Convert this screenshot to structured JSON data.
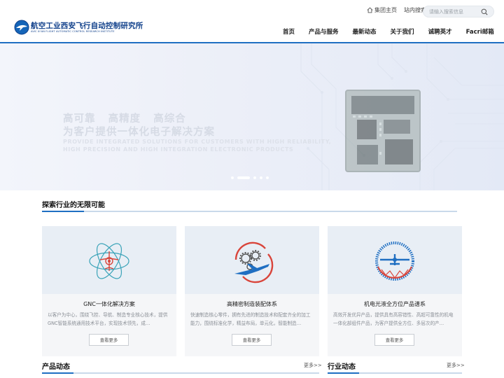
{
  "header": {
    "logo_cn": "航空工业西安飞行自动控制研究所",
    "logo_en": "AVIC XI'AN FLIGHT AUTOMATIC CONTROL RESEARCH INSTITUTE",
    "top_links": [
      "集团主页",
      "站内搜索"
    ],
    "search_placeholder": "请输入搜索信息",
    "nav": [
      "首页",
      "产品与服务",
      "最新动态",
      "关于我们",
      "诚聘英才",
      "Facri邮箱"
    ]
  },
  "banner": {
    "title_line1": "高可靠   高精度   高综合",
    "title_line2": "为客户提供一体化电子解决方案",
    "en_line1": "PROVIDE INTEGRATED SOLUTIONS FOR CUSTOMERS WITH HIGH RELIABILITY,",
    "en_line2": "HIGH PRECISION AND HIGH INTEGRATION ELECTRONIC  PRODUCTS",
    "slides": 5,
    "active_slide": 2
  },
  "explore": {
    "title": "探索行业的无限可能",
    "cards": [
      {
        "icon": "gnc-aircraft-orbit-icon",
        "title": "GNC一体化解决方案",
        "desc": "以客户为中心，围绕飞控、导航、制造专业核心技术，提供GNC智能系统通用技术平台，实现技术领先，成…",
        "button": "查看更多"
      },
      {
        "icon": "gears-airplane-icon",
        "title": "高精密制造装配体系",
        "desc": "快速制造核心零件，拥有先进的制造技术和配套齐全的加工能力，围绕标准化学，精益布局，单元化，智能制造…",
        "button": "查看更多"
      },
      {
        "icon": "airplane-gauge-icon",
        "title": "机电光液全方位产品谱系",
        "desc": "高效开发优异产品，提供具有高容错性、高超可靠性的机电一体化部组件产品，为客户提供全方位、多层次的产…",
        "button": "查看更多"
      }
    ]
  },
  "bottom": {
    "product_news": "产品动态",
    "industry_news": "行业动态",
    "more": "更多>>"
  },
  "colors": {
    "brand_blue": "#1f6fc2",
    "logo_navy": "#0f3f8a",
    "icon_red": "#d9453b",
    "icon_teal": "#3aa3b8"
  }
}
